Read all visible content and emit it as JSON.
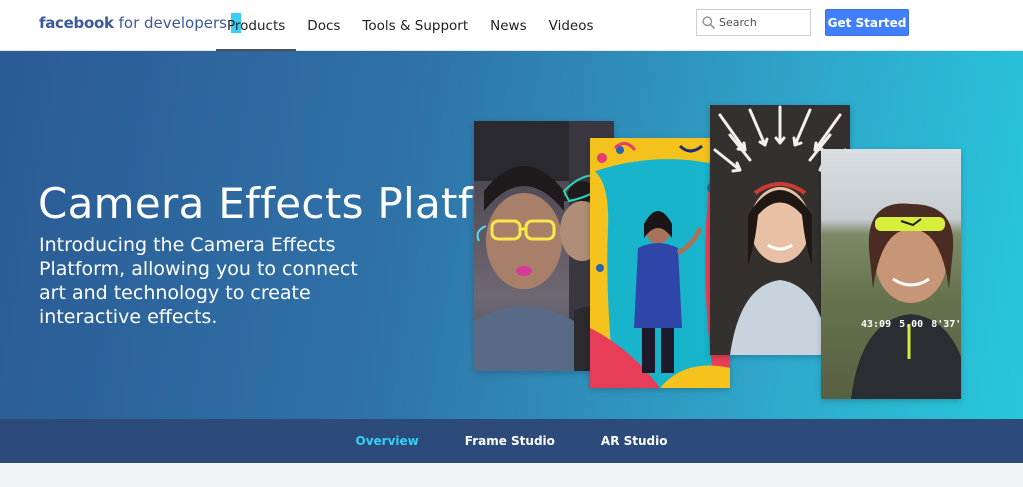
{
  "header": {
    "logo_brand": "facebook",
    "logo_suffix": "for developers",
    "nav": [
      {
        "label": "Products",
        "active": true
      },
      {
        "label": "Docs"
      },
      {
        "label": "Tools & Support"
      },
      {
        "label": "News"
      },
      {
        "label": "Videos"
      }
    ],
    "search_placeholder": "Search",
    "search_icon": "search-icon",
    "cta_label": "Get Started"
  },
  "hero": {
    "title": "Camera Effects Platform",
    "description": "Introducing the Camera Effects Platform, allowing you to connect art and technology to create interactive effects.",
    "photo4_stats": [
      "43:09",
      "5.00",
      "8'37''"
    ]
  },
  "subnav": {
    "items": [
      {
        "label": "Overview",
        "active": true
      },
      {
        "label": "Frame Studio"
      },
      {
        "label": "AR Studio"
      }
    ]
  },
  "colors": {
    "brand": "#3b5998",
    "accent": "#4080ff",
    "subnav_bg": "#2c4a7a",
    "subnav_active": "#35d0f4"
  }
}
